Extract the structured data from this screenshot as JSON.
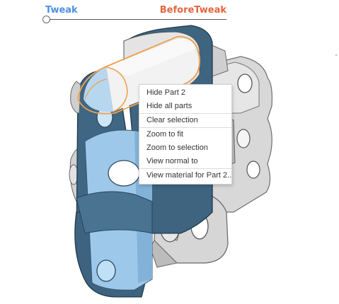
{
  "tweak": {
    "left_label": "Tweak",
    "right_label": "BeforeTweak",
    "left_color": "#4a90e2",
    "right_color": "#e0663d",
    "position": 0
  },
  "context_menu": {
    "items": [
      {
        "label": "Hide Part 2"
      },
      {
        "label": "Hide all parts"
      },
      {
        "label": "Clear selection"
      },
      {
        "label": "Zoom to fit"
      },
      {
        "label": "Zoom to selection"
      },
      {
        "label": "View normal to"
      },
      {
        "label": "View material for Part 2..."
      }
    ]
  },
  "colors": {
    "part_dark": "#3e6480",
    "part_light": "#9ec8ea",
    "part_grey": "#c9c9c9",
    "selection_orange": "#f0a050"
  }
}
